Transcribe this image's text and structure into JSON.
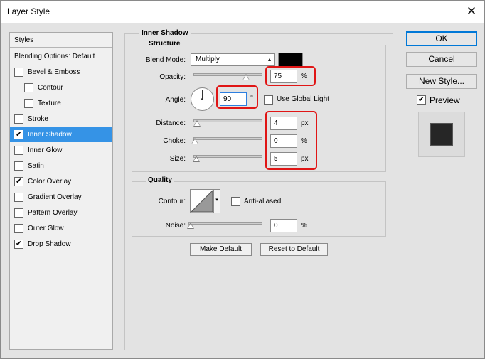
{
  "window": {
    "title": "Layer Style",
    "close_glyph": "✕"
  },
  "styles_panel": {
    "header": "Styles",
    "items": [
      {
        "label": "Blending Options: Default",
        "checkbox": false,
        "checked": false,
        "selected": false,
        "indent": false
      },
      {
        "label": "Bevel & Emboss",
        "checkbox": true,
        "checked": false,
        "selected": false,
        "indent": false
      },
      {
        "label": "Contour",
        "checkbox": true,
        "checked": false,
        "selected": false,
        "indent": true
      },
      {
        "label": "Texture",
        "checkbox": true,
        "checked": false,
        "selected": false,
        "indent": true
      },
      {
        "label": "Stroke",
        "checkbox": true,
        "checked": false,
        "selected": false,
        "indent": false
      },
      {
        "label": "Inner Shadow",
        "checkbox": true,
        "checked": true,
        "selected": true,
        "indent": false
      },
      {
        "label": "Inner Glow",
        "checkbox": true,
        "checked": false,
        "selected": false,
        "indent": false
      },
      {
        "label": "Satin",
        "checkbox": true,
        "checked": false,
        "selected": false,
        "indent": false
      },
      {
        "label": "Color Overlay",
        "checkbox": true,
        "checked": true,
        "selected": false,
        "indent": false
      },
      {
        "label": "Gradient Overlay",
        "checkbox": true,
        "checked": false,
        "selected": false,
        "indent": false
      },
      {
        "label": "Pattern Overlay",
        "checkbox": true,
        "checked": false,
        "selected": false,
        "indent": false
      },
      {
        "label": "Outer Glow",
        "checkbox": true,
        "checked": false,
        "selected": false,
        "indent": false
      },
      {
        "label": "Drop Shadow",
        "checkbox": true,
        "checked": true,
        "selected": false,
        "indent": false
      }
    ]
  },
  "inner_shadow": {
    "section_title": "Inner Shadow",
    "structure_title": "Structure",
    "blend_mode_label": "Blend Mode:",
    "blend_mode_value": "Multiply",
    "blend_color": "#000000",
    "opacity_label": "Opacity:",
    "opacity_value": "75",
    "opacity_unit": "%",
    "opacity_level": 0.75,
    "angle_label": "Angle:",
    "angle_value": "90",
    "angle_unit": "°",
    "use_global_light_label": "Use Global Light",
    "use_global_light_checked": false,
    "distance_label": "Distance:",
    "distance_value": "4",
    "distance_unit": "px",
    "choke_label": "Choke:",
    "choke_value": "0",
    "choke_unit": "%",
    "size_label": "Size:",
    "size_value": "5",
    "size_unit": "px",
    "quality_title": "Quality",
    "contour_label": "Contour:",
    "anti_aliased_label": "Anti-aliased",
    "anti_aliased_checked": false,
    "noise_label": "Noise:",
    "noise_value": "0",
    "noise_unit": "%",
    "make_default_label": "Make Default",
    "reset_default_label": "Reset to Default"
  },
  "buttons": {
    "ok": "OK",
    "cancel": "Cancel",
    "new_style": "New Style...",
    "preview_label": "Preview",
    "preview_checked": true
  },
  "colors": {
    "selection": "#3593e6",
    "highlight_annotation": "#e01515",
    "preview_fill": "#262626"
  }
}
